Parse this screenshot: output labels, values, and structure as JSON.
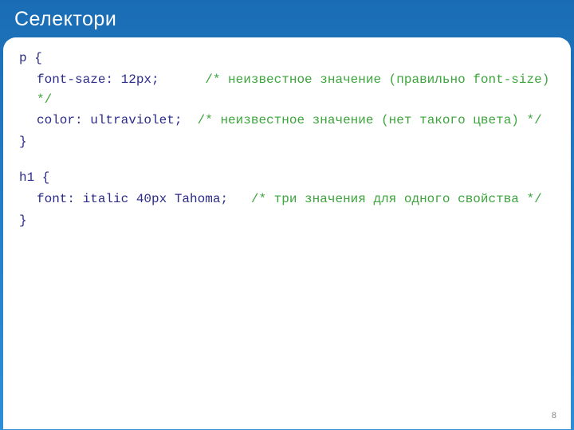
{
  "header": {
    "title": "Селектори"
  },
  "code": {
    "l1": "p {",
    "l2_code": "font-saze: 12px;      ",
    "l2_comment": "/* неизвестное значение (правильно font-size) */",
    "l3_code": "color: ultraviolet;  ",
    "l3_comment": "/* неизвестное значение (нет такого цвета) */",
    "l4": "}",
    "l5": "h1 {",
    "l6_code": "font: italic 40px Tahoma;   ",
    "l6_comment": "/* три значения для одного свойства */",
    "l7": "}"
  },
  "page_number": "8"
}
